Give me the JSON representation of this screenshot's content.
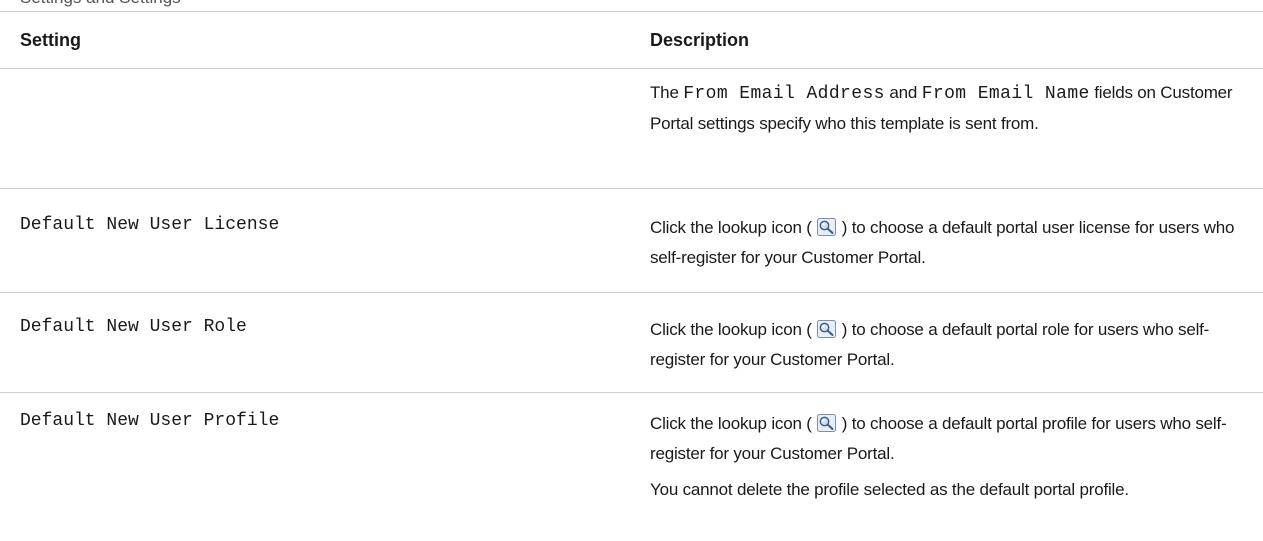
{
  "header": {
    "title_partial": "Settings and Settings",
    "setting_col": "Setting",
    "description_col": "Description"
  },
  "rows": [
    {
      "setting": "",
      "desc": {
        "part1": "The",
        "code1": "From Email Address",
        "part2": "and",
        "code2": "From Email Name",
        "part3": "fields on Customer Portal settings specify who this template is sent from."
      }
    },
    {
      "setting": "Default New User License",
      "desc": {
        "before_icon": "Click the lookup icon (",
        "after_icon": ") to choose a default portal user license for users who self-register for your Customer Portal."
      }
    },
    {
      "setting": "Default New User Role",
      "desc": {
        "before_icon": "Click the lookup icon (",
        "after_icon": ") to choose a default portal role for users who self-register for your Customer Portal."
      }
    },
    {
      "setting": "Default New User Profile",
      "desc": {
        "before_icon": "Click the lookup icon (",
        "after_icon": ") to choose a default portal profile for users who self-register for your Customer Portal.",
        "note": "You cannot delete the profile selected as the default portal profile."
      }
    }
  ],
  "colors": {
    "rule": "#cfcfcf",
    "text": "#1a1a1a"
  }
}
